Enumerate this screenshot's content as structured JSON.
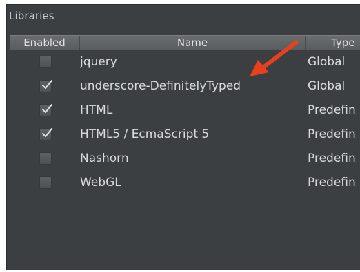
{
  "panel": {
    "title": "Libraries"
  },
  "table": {
    "columns": [
      "Enabled",
      "Name",
      "Type"
    ],
    "rows": [
      {
        "enabled": false,
        "name": "jquery",
        "type": "Global"
      },
      {
        "enabled": true,
        "name": "underscore-DefinitelyTyped",
        "type": "Global"
      },
      {
        "enabled": true,
        "name": "HTML",
        "type": "Predefin"
      },
      {
        "enabled": true,
        "name": "HTML5 / EcmaScript 5",
        "type": "Predefin"
      },
      {
        "enabled": false,
        "name": "Nashorn",
        "type": "Predefin"
      },
      {
        "enabled": false,
        "name": "WebGL",
        "type": "Predefin"
      }
    ]
  },
  "colors": {
    "panel_bg": "#3c3f41",
    "text": "#d8dadb",
    "arrow": "#e8401c"
  },
  "icons": {
    "check": "check-icon",
    "annotation_arrow": "arrow-icon"
  }
}
